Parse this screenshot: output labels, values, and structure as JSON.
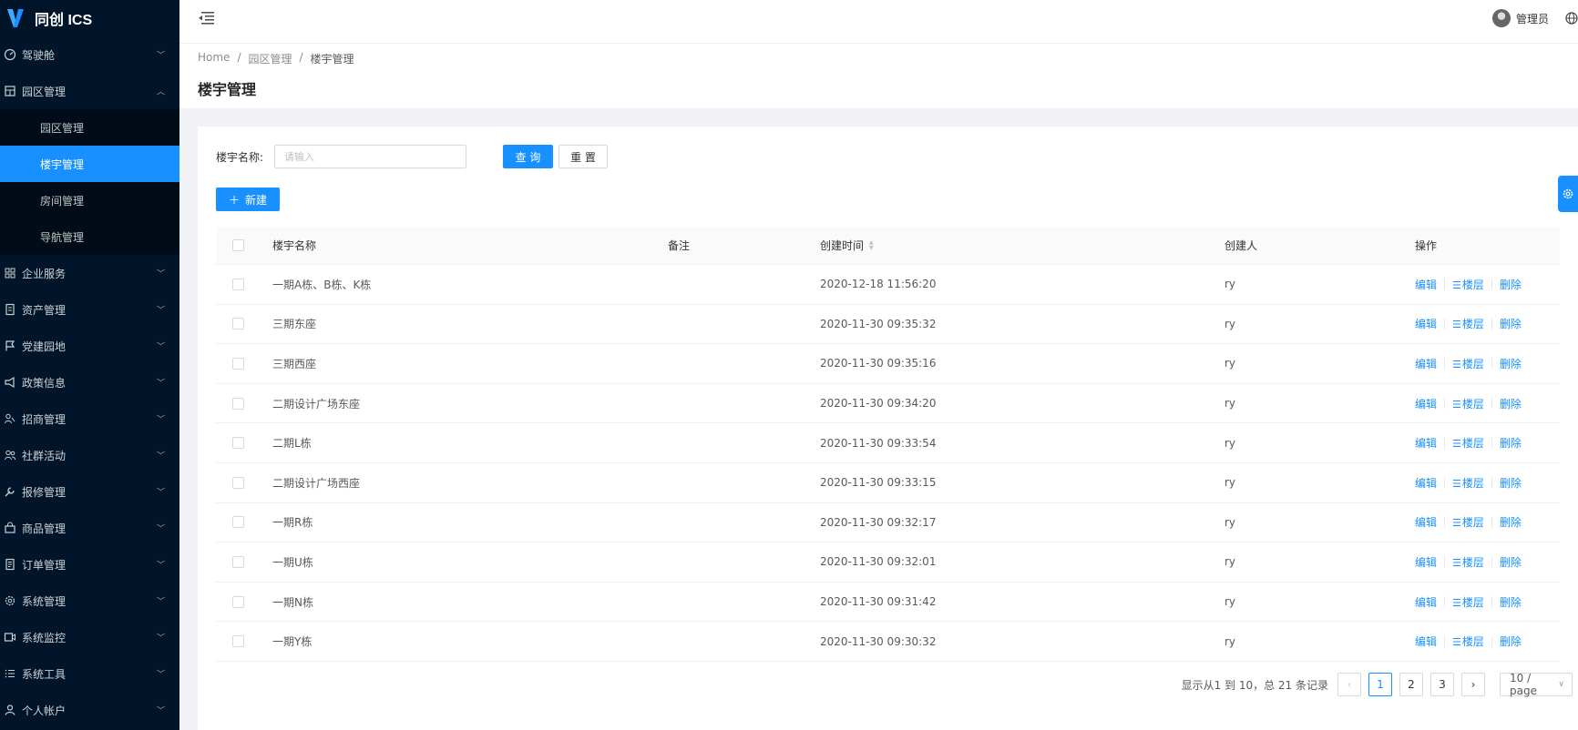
{
  "app": {
    "title": "同创 ICS"
  },
  "sidebar": {
    "items": [
      {
        "label": "驾驶舱",
        "icon": "dashboard-icon",
        "expanded": false
      },
      {
        "label": "园区管理",
        "icon": "building-icon",
        "expanded": true,
        "children": [
          {
            "label": "园区管理",
            "active": false
          },
          {
            "label": "楼宇管理",
            "active": true
          },
          {
            "label": "房间管理",
            "active": false
          },
          {
            "label": "导航管理",
            "active": false
          }
        ]
      },
      {
        "label": "企业服务",
        "icon": "appstore-icon",
        "expanded": false
      },
      {
        "label": "资产管理",
        "icon": "asset-icon",
        "expanded": false
      },
      {
        "label": "党建园地",
        "icon": "flag-icon",
        "expanded": false
      },
      {
        "label": "政策信息",
        "icon": "notification-icon",
        "expanded": false
      },
      {
        "label": "招商管理",
        "icon": "team-icon",
        "expanded": false
      },
      {
        "label": "社群活动",
        "icon": "usergroup-icon",
        "expanded": false
      },
      {
        "label": "报修管理",
        "icon": "tool-icon",
        "expanded": false
      },
      {
        "label": "商品管理",
        "icon": "shop-icon",
        "expanded": false
      },
      {
        "label": "订单管理",
        "icon": "order-icon",
        "expanded": false
      },
      {
        "label": "系统管理",
        "icon": "setting-icon",
        "expanded": false
      },
      {
        "label": "系统监控",
        "icon": "monitor-icon",
        "expanded": false
      },
      {
        "label": "系统工具",
        "icon": "bars-icon",
        "expanded": false
      },
      {
        "label": "个人帐户",
        "icon": "user-icon",
        "expanded": false
      }
    ]
  },
  "header": {
    "username": "管理员"
  },
  "breadcrumb": [
    "Home",
    "园区管理",
    "楼宇管理"
  ],
  "page": {
    "title": "楼宇管理"
  },
  "search": {
    "label": "楼宇名称:",
    "placeholder": "请输入",
    "value": "",
    "query_label": "查 询",
    "reset_label": "重 置"
  },
  "toolbar": {
    "new_label": "新建"
  },
  "table": {
    "columns": [
      "楼宇名称",
      "备注",
      "创建时间",
      "创建人",
      "操作"
    ],
    "actions": {
      "edit": "编辑",
      "floors": "楼层",
      "delete": "删除"
    },
    "rows": [
      {
        "name": "一期A栋、B栋、K栋",
        "remark": "",
        "created": "2020-12-18 11:56:20",
        "creator": "ry"
      },
      {
        "name": "三期东座",
        "remark": "",
        "created": "2020-11-30 09:35:32",
        "creator": "ry"
      },
      {
        "name": "三期西座",
        "remark": "",
        "created": "2020-11-30 09:35:16",
        "creator": "ry"
      },
      {
        "name": "二期设计广场东座",
        "remark": "",
        "created": "2020-11-30 09:34:20",
        "creator": "ry"
      },
      {
        "name": "二期L栋",
        "remark": "",
        "created": "2020-11-30 09:33:54",
        "creator": "ry"
      },
      {
        "name": "二期设计广场西座",
        "remark": "",
        "created": "2020-11-30 09:33:15",
        "creator": "ry"
      },
      {
        "name": "一期R栋",
        "remark": "",
        "created": "2020-11-30 09:32:17",
        "creator": "ry"
      },
      {
        "name": "一期U栋",
        "remark": "",
        "created": "2020-11-30 09:32:01",
        "creator": "ry"
      },
      {
        "name": "一期N栋",
        "remark": "",
        "created": "2020-11-30 09:31:42",
        "creator": "ry"
      },
      {
        "name": "一期Y栋",
        "remark": "",
        "created": "2020-11-30 09:30:32",
        "creator": "ry"
      }
    ]
  },
  "pagination": {
    "total_text": "显示从1 到 10，总 21 条记录",
    "pages": [
      "1",
      "2",
      "3"
    ],
    "current": "1",
    "page_size": "10 / page"
  },
  "colors": {
    "primary": "#1890ff",
    "sidebar_bg": "#001529",
    "submenu_bg": "#000c17"
  }
}
